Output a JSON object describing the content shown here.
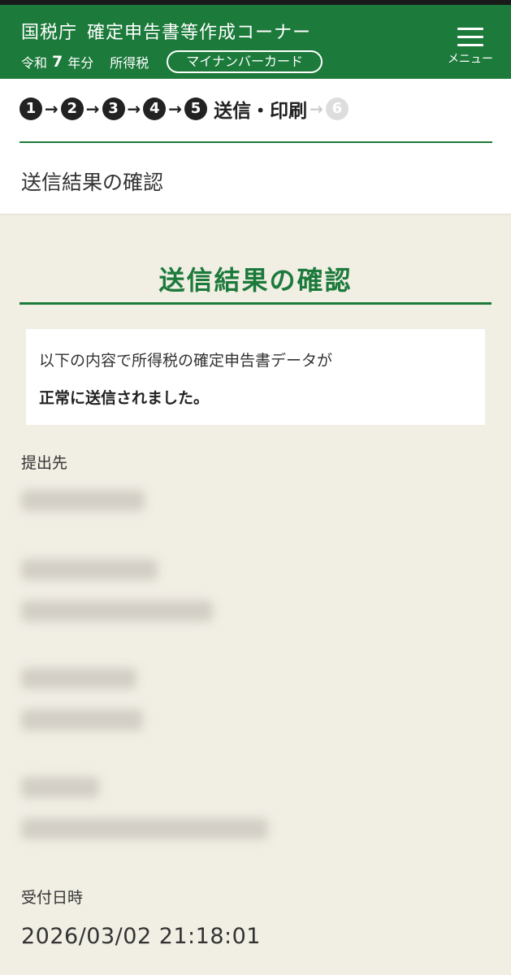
{
  "header": {
    "title_org": "国税庁",
    "title_main": "確定申告書等作成コーナー",
    "era": "令和",
    "year": "7",
    "year_suffix": "年分",
    "tax_type": "所得税",
    "method_badge": "マイナンバーカード",
    "menu_label": "メニュー",
    "color": "#1c7a3b"
  },
  "steps": {
    "items": [
      "1",
      "2",
      "3",
      "4",
      "5",
      "6"
    ],
    "current_label": "送信・印刷",
    "current_index": 5
  },
  "page": {
    "subtitle": "送信結果の確認",
    "heading": "送信結果の確認"
  },
  "message": {
    "line1": "以下の内容で所得税の確定申告書データが",
    "line2": "正常に送信されました。"
  },
  "fields": {
    "submit_to_label": "提出先",
    "received_label": "受付日時",
    "received_value": "2026/03/02  21:18:01"
  }
}
